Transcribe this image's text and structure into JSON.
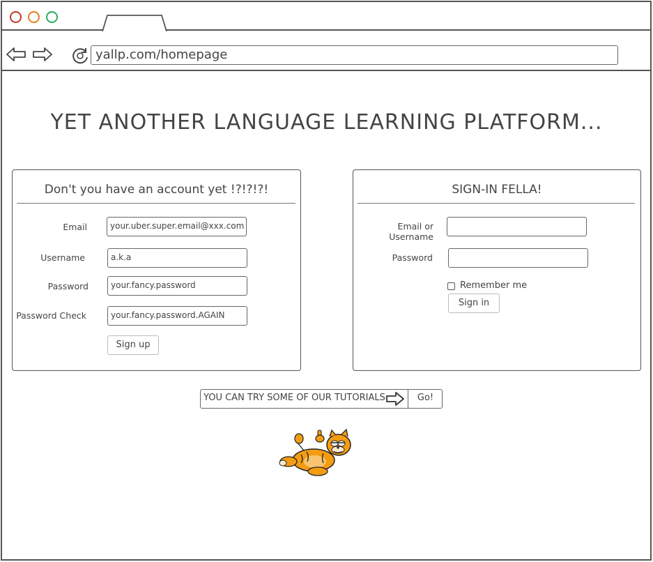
{
  "browser": {
    "url": "yallp.com/homepage",
    "window_buttons": [
      {
        "name": "close",
        "color": "#c0392b"
      },
      {
        "name": "minimize",
        "color": "#e67e22"
      },
      {
        "name": "maximize",
        "color": "#27ae60"
      }
    ]
  },
  "page": {
    "headline": "YET ANOTHER LANGUAGE LEARNING PLATFORM..."
  },
  "signup": {
    "title": "Don't you have an account yet !?!?!?!",
    "fields": [
      {
        "label": "Email",
        "value": "your.uber.super.email@xxx.com"
      },
      {
        "label": "Username",
        "value": "a.k.a"
      },
      {
        "label": "Password",
        "value": "your.fancy.password"
      },
      {
        "label": "Password Check",
        "value": "your.fancy.password.AGAIN"
      }
    ],
    "button": "Sign up"
  },
  "signin": {
    "title": "SIGN-IN FELLA!",
    "fields": [
      {
        "label": "Email or Username",
        "value": ""
      },
      {
        "label": "Password",
        "value": ""
      }
    ],
    "remember_label": "Remember me",
    "button": "Sign in"
  },
  "tutorial": {
    "text": "YOU CAN TRY SOME OF OUR TUTORIALS",
    "go_label": "Go!"
  },
  "mascot": {
    "icon": "garfield-cat-icon"
  }
}
